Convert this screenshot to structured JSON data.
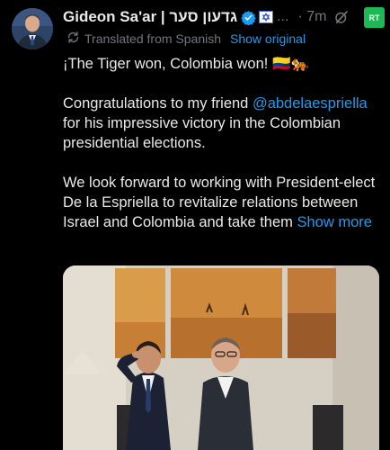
{
  "author": {
    "name": "Gideon Sa'ar | גדעון סער",
    "ellipsis": "...",
    "timestamp": "· 7m"
  },
  "translation": {
    "label": "Translated from Spanish",
    "show_original": "Show original"
  },
  "tweet": {
    "line1": "¡The Tiger won, Colombia won!",
    "line1_emoji": "🇨🇴🐅",
    "p2_before": "Congratulations to my friend",
    "mention": "@abdelaespriella",
    "p2_after": "for his impressive victory in the Colombian presidential elections.",
    "p3": "We look forward to working with President-elect De la Espriella to revitalize relations between Israel and Colombia and take them",
    "show_more": "Show more"
  },
  "badge": {
    "label": "RT"
  },
  "colors": {
    "background": "#000000",
    "text": "#e7e9ea",
    "muted": "#71767b",
    "link": "#1d9bf0",
    "verified": "#1d9bf0",
    "rt_green": "#1db954"
  },
  "icons": [
    "verified-badge-icon",
    "israel-flag-badge-icon",
    "grok-icon",
    "translate-icon",
    "rt-logo-icon"
  ]
}
